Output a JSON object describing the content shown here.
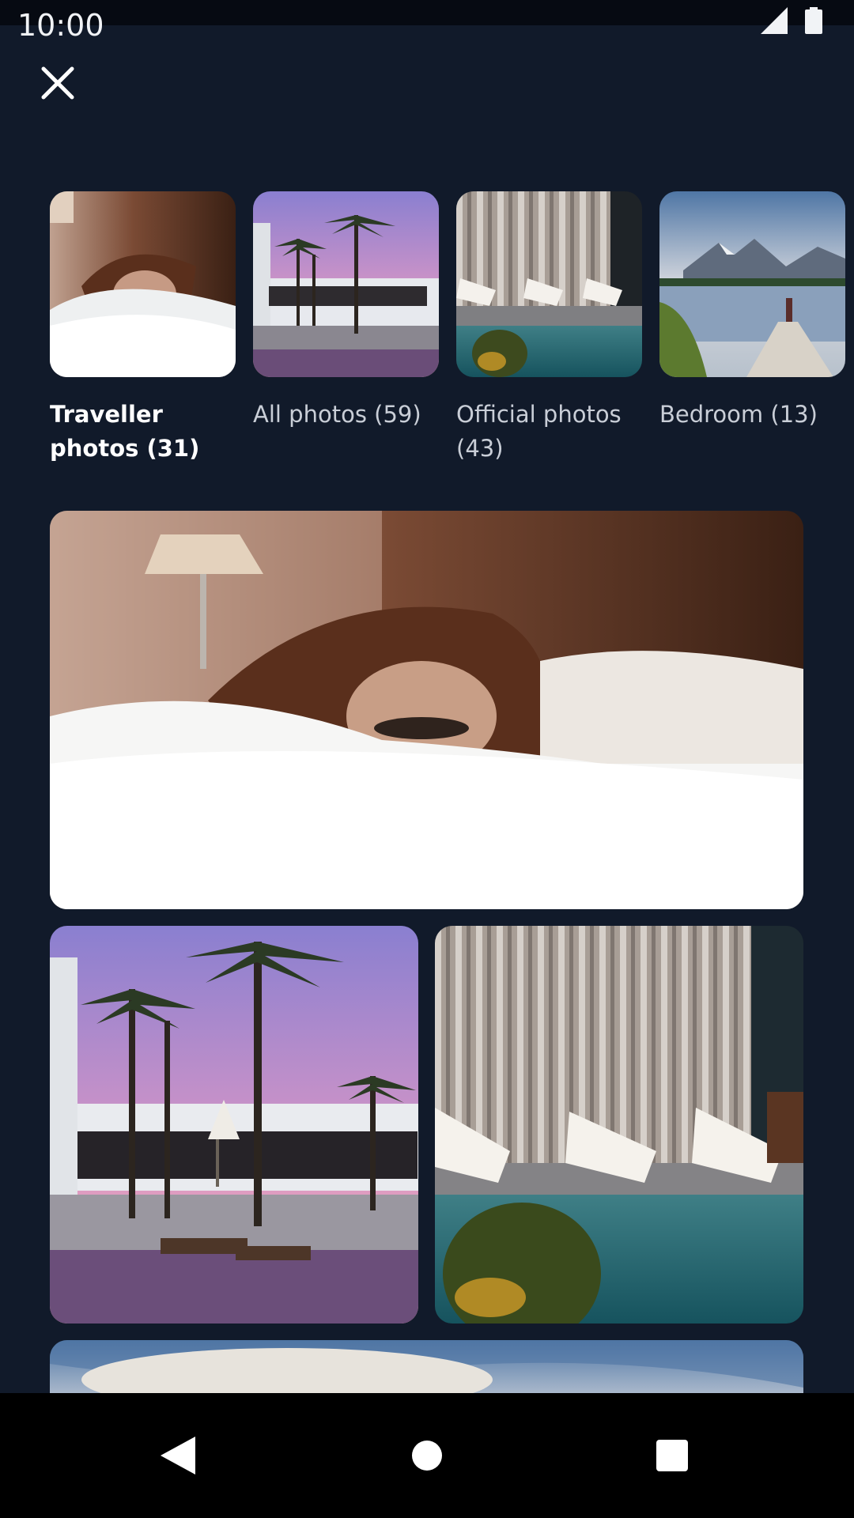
{
  "status_bar": {
    "time": "10:00",
    "icons": [
      "signal-icon",
      "battery-icon"
    ]
  },
  "header": {
    "close_icon": "close-icon"
  },
  "albums": [
    {
      "label": "Traveller photos (31)",
      "selected": true,
      "thumbnail": "woman-in-bed"
    },
    {
      "label": "All photos (59)",
      "selected": false,
      "thumbnail": "palm-trees-pool-sunset"
    },
    {
      "label": "Official photos (43)",
      "selected": false,
      "thumbnail": "poolside-deck-chairs"
    },
    {
      "label": "Bedroom (13)",
      "selected": false,
      "thumbnail": "mountain-lake-dock"
    }
  ],
  "photos": [
    {
      "subject": "woman-in-bed"
    },
    {
      "subject": "palm-trees-pool-sunset"
    },
    {
      "subject": "poolside-deck-chairs"
    },
    {
      "subject": "mountain-lake-dock"
    }
  ],
  "nav_bar": {
    "buttons": [
      "back-icon",
      "home-icon",
      "recents-icon"
    ]
  },
  "colors": {
    "background": "#111a2a",
    "status_bar": "#060a12",
    "nav_bar": "#000000",
    "label_active": "#ffffff",
    "label_inactive": "#c9ced7"
  }
}
